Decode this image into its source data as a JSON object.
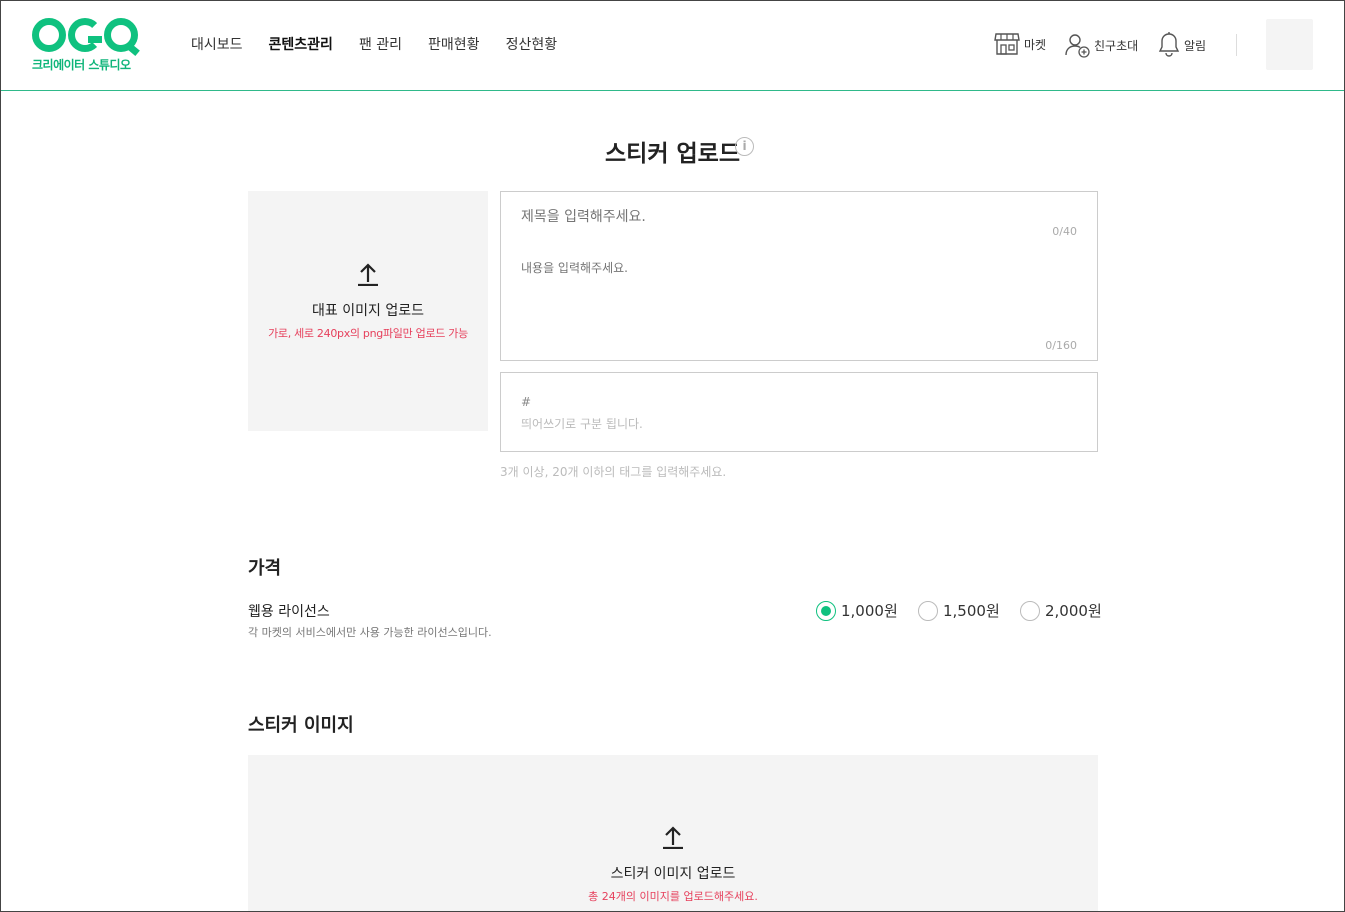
{
  "header": {
    "logo_sub": "크리에이터 스튜디오",
    "nav": [
      {
        "label": "대시보드",
        "active": false
      },
      {
        "label": "콘텐츠관리",
        "active": true
      },
      {
        "label": "팬 관리",
        "active": false
      },
      {
        "label": "판매현황",
        "active": false
      },
      {
        "label": "정산현황",
        "active": false
      }
    ],
    "utils": {
      "market": "마켓",
      "invite": "친구초대",
      "alarm": "알림"
    }
  },
  "page": {
    "title": "스티커 업로드"
  },
  "thumbnail": {
    "label": "대표 이미지 업로드",
    "hint": "가로, 세로 240px의 png파일만 업로드 가능"
  },
  "form": {
    "title_placeholder": "제목을 입력해주세요.",
    "title_count": "0/40",
    "desc_placeholder": "내용을 입력해주세요.",
    "desc_count": "0/160",
    "tag_hash": "#",
    "tag_placeholder": "띄어쓰기로 구분 됩니다.",
    "tag_hint": "3개 이상, 20개 이하의 태그를 입력해주세요."
  },
  "price": {
    "section_title": "가격",
    "license_name": "웹용 라이선스",
    "license_desc": "각 마켓의 서비스에서만 사용 가능한 라이선스입니다.",
    "options": [
      {
        "label": "1,000원",
        "checked": true
      },
      {
        "label": "1,500원",
        "checked": false
      },
      {
        "label": "2,000원",
        "checked": false
      }
    ],
    "accent_color": "#0fc17f"
  },
  "sticker": {
    "section_title": "스티커 이미지",
    "upload_label": "스티커 이미지 업로드",
    "upload_hint": "총 24개의 이미지를 업로드해주세요."
  }
}
